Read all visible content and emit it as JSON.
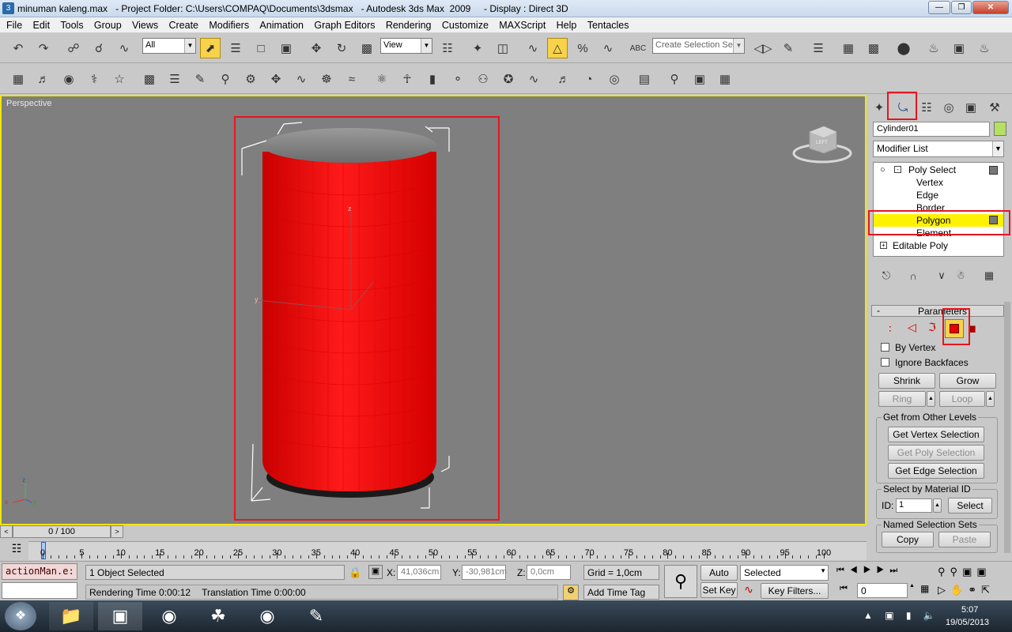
{
  "title_bar": {
    "file": "minuman kaleng.max",
    "project_folder": "   - Project Folder: C:\\Users\\COMPAQ\\Documents\\3dsmax",
    "app": "   - Autodesk 3ds Max  2009",
    "display": "     - Display : Direct 3D"
  },
  "menu": [
    "File",
    "Edit",
    "Tools",
    "Group",
    "Views",
    "Create",
    "Modifiers",
    "Animation",
    "Graph Editors",
    "Rendering",
    "Customize",
    "MAXScript",
    "Help",
    "Tentacles"
  ],
  "toolbar": {
    "filter_value": "All",
    "coord_value": "View",
    "selection_set_placeholder": "Create Selection Set"
  },
  "viewport": {
    "label": "Perspective",
    "viewcube_label": "LEFT",
    "gizmo_z": "z",
    "gizmo_y": "y",
    "axis_x": "x",
    "axis_y": "y",
    "axis_z": "z"
  },
  "command_panel": {
    "object_name": "Cylinder01",
    "modifier_list": "Modifier List",
    "stack": {
      "poly_select": "Poly Select",
      "vertex": "Vertex",
      "edge": "Edge",
      "border": "Border",
      "polygon": "Polygon",
      "element": "Element",
      "editable_poly": "Editable Poly"
    },
    "parameters": {
      "title": "Parameters",
      "by_vertex": "By Vertex",
      "ignore_backfaces": "Ignore Backfaces",
      "shrink": "Shrink",
      "grow": "Grow",
      "ring": "Ring",
      "loop": "Loop",
      "get_from_other_levels": "Get from Other Levels",
      "get_vertex_selection": "Get Vertex Selection",
      "get_poly_selection": "Get Poly Selection",
      "get_edge_selection": "Get Edge Selection",
      "select_by_material_id": "Select by Material ID",
      "id_label": "ID:",
      "id_value": "1",
      "select": "Select",
      "named_selection_sets": "Named Selection Sets",
      "copy": "Copy",
      "paste": "Paste"
    }
  },
  "timeline": {
    "frame_display": "0 / 100",
    "ticks": [
      "0",
      "5",
      "10",
      "15",
      "20",
      "25",
      "30",
      "35",
      "40",
      "45",
      "50",
      "55",
      "60",
      "65",
      "70",
      "75",
      "80",
      "85",
      "90",
      "95",
      "100"
    ]
  },
  "status": {
    "maxscript": "actionMan.e:",
    "objects_selected": "1 Object Selected",
    "rendering_time": "Rendering Time  0:00:12",
    "translation_time": "Translation Time  0:00:00",
    "x_label": "X:",
    "x_value": "41,036cm",
    "y_label": "Y:",
    "y_value": "-30,981cm",
    "z_label": "Z:",
    "z_value": "0,0cm",
    "grid": "Grid = 1,0cm",
    "add_time_tag": "Add Time Tag",
    "auto_key": "Auto Key",
    "set_key": "Set Key",
    "selected": "Selected",
    "key_filters": "Key Filters...",
    "frame_value": "0"
  },
  "taskbar": {
    "time": "5:07",
    "date": "19/05/2013"
  },
  "colors": {
    "viewport_bg": "#7f7f7f",
    "active_border": "#f2e600",
    "cylinder": "#ff1010",
    "highlight": "#f7d24a",
    "annotation_red": "#e8141e"
  }
}
